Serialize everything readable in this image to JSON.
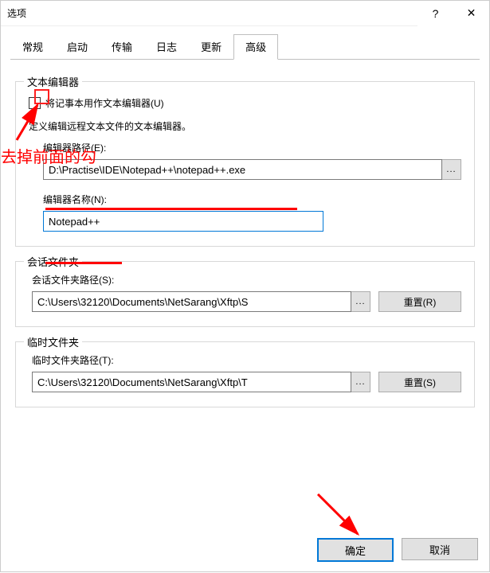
{
  "window": {
    "title": "选项",
    "help_glyph": "?",
    "close_glyph": "✕"
  },
  "tabs": [
    "常规",
    "启动",
    "传输",
    "日志",
    "更新",
    "高级"
  ],
  "active_tab_index": 5,
  "editor_group": {
    "legend": "文本编辑器",
    "use_notepad_label": "将记事本用作文本编辑器(U)",
    "use_notepad_checked": false,
    "define_hint": "定义编辑远程文本文件的文本编辑器。",
    "path_label": "编辑器路径(E):",
    "path_value": "D:\\Practise\\IDE\\Notepad++\\notepad++.exe",
    "browse_glyph": "...",
    "name_label": "编辑器名称(N):",
    "name_value": "Notepad++"
  },
  "session_group": {
    "legend": "会话文件夹",
    "path_label": "会话文件夹路径(S):",
    "path_value": "C:\\Users\\32120\\Documents\\NetSarang\\Xftp\\S",
    "browse_glyph": "...",
    "reset_label": "重置(R)"
  },
  "temp_group": {
    "legend": "临时文件夹",
    "path_label": "临时文件夹路径(T):",
    "path_value": "C:\\Users\\32120\\Documents\\NetSarang\\Xftp\\T",
    "browse_glyph": "...",
    "reset_label": "重置(S)"
  },
  "footer": {
    "ok": "确定",
    "cancel": "取消"
  },
  "annotations": {
    "uncheck_note": "去掉前面的勾"
  }
}
